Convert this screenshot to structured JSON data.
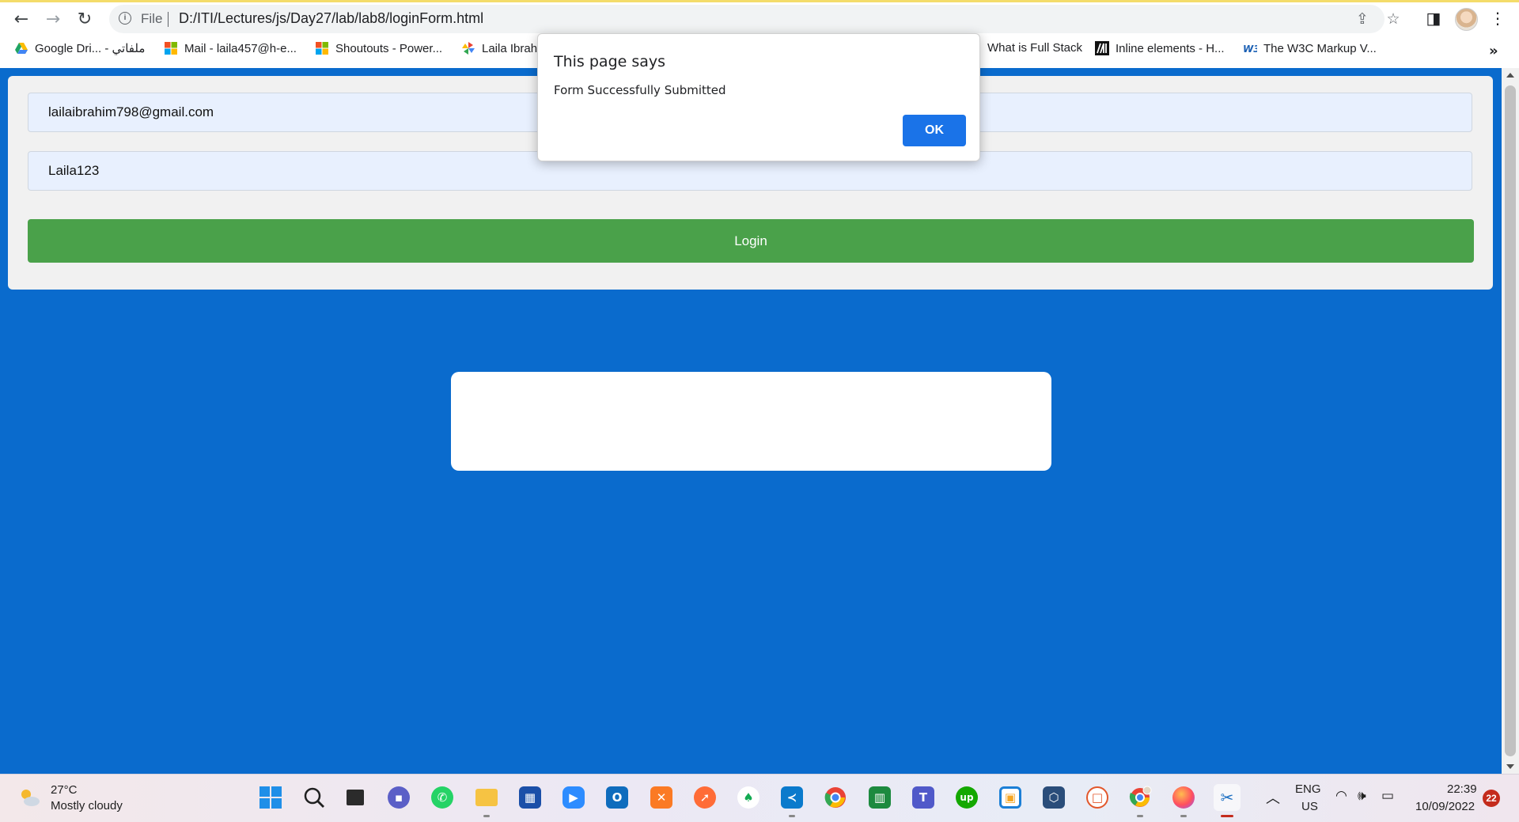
{
  "browser": {
    "file_label": "File",
    "url": "D:/ITI/Lectures/js/Day27/lab/lab8/loginForm.html",
    "bookmarks": [
      {
        "label": "Google Dri... - ملفاتي",
        "icon": "google-drive-icon"
      },
      {
        "label": "Mail - laila457@h-e...",
        "icon": "microsoft-icon"
      },
      {
        "label": "Shoutouts - Power...",
        "icon": "microsoft-icon"
      },
      {
        "label": "Laila Ibrah",
        "icon": "pinwheel-icon"
      },
      {
        "label": "What is Full Stack",
        "icon": "blank"
      },
      {
        "label": "Inline elements - H...",
        "icon": "mdn-icon"
      },
      {
        "label": "The W3C Markup V...",
        "icon": "w3c-icon"
      }
    ],
    "more_label": "»"
  },
  "form": {
    "email_value": "lailaibrahim798@gmail.com",
    "password_value": "Laila123",
    "login_label": "Login"
  },
  "dialog": {
    "title": "This page says",
    "message": "Form Successfully Submitted",
    "ok_label": "OK"
  },
  "taskbar": {
    "weather_temp": "27°C",
    "weather_desc": "Mostly cloudy",
    "lang_line1": "ENG",
    "lang_line2": "US",
    "time": "22:39",
    "date": "10/09/2022",
    "notifications": "22",
    "apps": [
      "start",
      "search",
      "task-view",
      "teams-chat",
      "whatsapp",
      "file-explorer",
      "store",
      "zoom",
      "outlook",
      "xampp",
      "postman",
      "mongodb",
      "vscode",
      "chrome",
      "excel",
      "teams",
      "upwork",
      "virtual-box-green",
      "virtualbox",
      "office-remote",
      "chrome-profile",
      "firefox",
      "snipping-tool"
    ]
  },
  "colors": {
    "page_bg": "#0a6bcd",
    "login_button": "#4aa14a",
    "dialog_ok": "#1a73e8"
  }
}
